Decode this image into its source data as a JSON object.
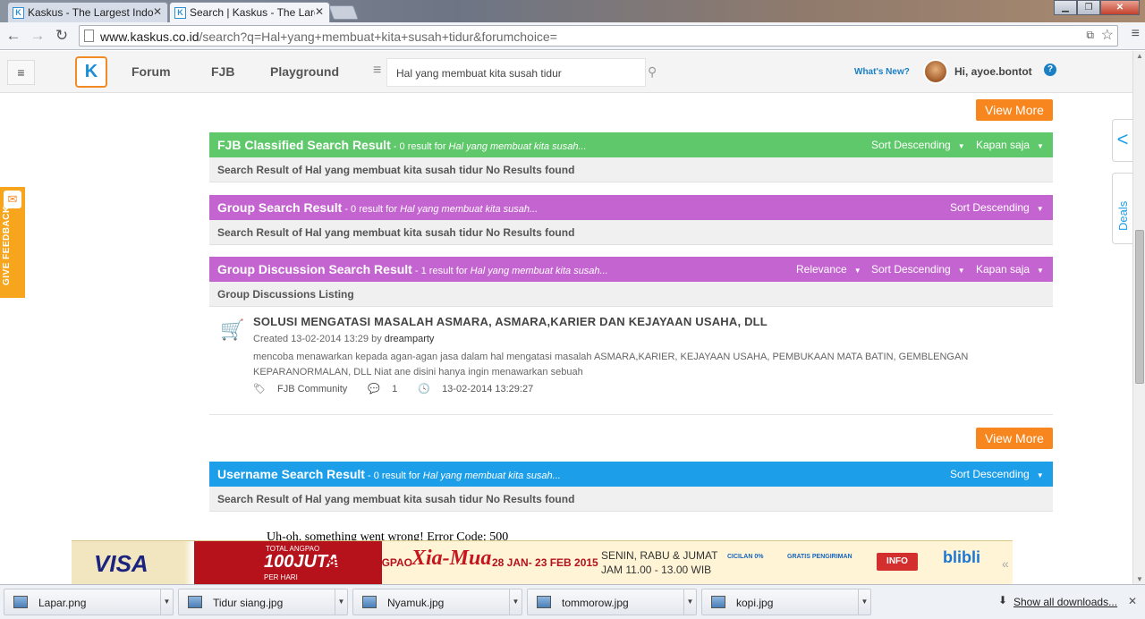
{
  "browser": {
    "tabs": [
      {
        "title": "Kaskus - The Largest Indo"
      },
      {
        "title": "Search | Kaskus - The Larg"
      }
    ],
    "url_host": "www.kaskus.co.id",
    "url_path": "/search?q=Hal+yang+membuat+kita+susah+tidur&forumchoice="
  },
  "header": {
    "nav": [
      "Forum",
      "FJB",
      "Playground"
    ],
    "search_value": "Hal yang membuat kita susah tidur",
    "whats_new": "What's New?",
    "greeting": "Hi, ayoe.bontot"
  },
  "view_more_label": "View More",
  "sections": {
    "fjb": {
      "title": "FJB Classified Search Result",
      "count": " - 0 result for ",
      "query": "Hal yang membuat kita susah...",
      "sort": "Sort Descending",
      "time": "Kapan saja",
      "message": "Search Result of Hal yang membuat kita susah tidur No Results found"
    },
    "group": {
      "title": "Group Search Result",
      "count": " - 0 result for ",
      "query": "Hal yang membuat kita susah...",
      "sort": "Sort Descending",
      "message": "Search Result of Hal yang membuat kita susah tidur No Results found"
    },
    "group_discussion": {
      "title": "Group Discussion Search Result",
      "count": " - 1 result for ",
      "query": "Hal yang membuat kita susah...",
      "relevance": "Relevance",
      "sort": "Sort Descending",
      "time": "Kapan saja",
      "listing": "Group Discussions Listing"
    },
    "username": {
      "title": "Username Search Result",
      "count": " - 0 result for ",
      "query": "Hal yang membuat kita susah...",
      "sort": "Sort Descending",
      "message": "Search Result of Hal yang membuat kita susah tidur No Results found"
    }
  },
  "result": {
    "title": "SOLUSI MENGATASI MASALAH ASMARA, ASMARA,KARIER DAN KEJAYAAN USAHA, DLL",
    "created": "Created 13-02-2014 13:29 by ",
    "author": "dreamparty",
    "description": "mencoba menawarkan kepada agan-agan jasa dalam hal mengatasi masalah ASMARA,KARIER, KEJAYAAN USAHA, PEMBUKAAN MATA BATIN, GEMBLENGAN KEPARANORMALAN, DLL Niat ane disini hanya ingin menawarkan sebuah",
    "community": "FJB Community",
    "replies": "1",
    "timestamp": "13-02-2014 13:29:27"
  },
  "error_text": "Uh-oh, something went wrong! Error Code: 500",
  "feedback_label": "GIVE FEEDBACK",
  "deals_label": "Deals",
  "ad": {
    "visa": "VISA",
    "promo_top": "TOTAL ANGPAO",
    "promo_main": "100JUTA",
    "promo_sub": "PER HARI",
    "rejeki": "REJEKI ANGPAO",
    "brand": "Xia-Mua",
    "dates": "28 JAN- 23 FEB 2015",
    "schedule_line1": "SENIN, RABU & JUMAT",
    "schedule_line2": "JAM 11.00 - 13.00 WIB",
    "cicilan": "CICILAN 0%",
    "gratis": "GRATIS PENGIRIMAN",
    "info": "INFO",
    "blibli": "blibli"
  },
  "downloads": {
    "items": [
      "Lapar.png",
      "Tidur siang.jpg",
      "Nyamuk.jpg",
      "tommorow.jpg",
      "kopi.jpg"
    ],
    "show_all": "Show all downloads..."
  }
}
